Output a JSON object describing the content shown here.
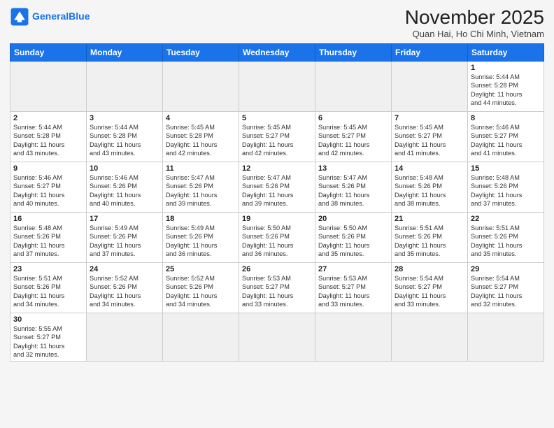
{
  "header": {
    "logo_general": "General",
    "logo_blue": "Blue",
    "month_title": "November 2025",
    "location": "Quan Hai, Ho Chi Minh, Vietnam"
  },
  "weekdays": [
    "Sunday",
    "Monday",
    "Tuesday",
    "Wednesday",
    "Thursday",
    "Friday",
    "Saturday"
  ],
  "weeks": [
    [
      {
        "day": "",
        "info": ""
      },
      {
        "day": "",
        "info": ""
      },
      {
        "day": "",
        "info": ""
      },
      {
        "day": "",
        "info": ""
      },
      {
        "day": "",
        "info": ""
      },
      {
        "day": "",
        "info": ""
      },
      {
        "day": "1",
        "info": "Sunrise: 5:44 AM\nSunset: 5:28 PM\nDaylight: 11 hours\nand 44 minutes."
      }
    ],
    [
      {
        "day": "2",
        "info": "Sunrise: 5:44 AM\nSunset: 5:28 PM\nDaylight: 11 hours\nand 43 minutes."
      },
      {
        "day": "3",
        "info": "Sunrise: 5:44 AM\nSunset: 5:28 PM\nDaylight: 11 hours\nand 43 minutes."
      },
      {
        "day": "4",
        "info": "Sunrise: 5:45 AM\nSunset: 5:28 PM\nDaylight: 11 hours\nand 42 minutes."
      },
      {
        "day": "5",
        "info": "Sunrise: 5:45 AM\nSunset: 5:27 PM\nDaylight: 11 hours\nand 42 minutes."
      },
      {
        "day": "6",
        "info": "Sunrise: 5:45 AM\nSunset: 5:27 PM\nDaylight: 11 hours\nand 42 minutes."
      },
      {
        "day": "7",
        "info": "Sunrise: 5:45 AM\nSunset: 5:27 PM\nDaylight: 11 hours\nand 41 minutes."
      },
      {
        "day": "8",
        "info": "Sunrise: 5:46 AM\nSunset: 5:27 PM\nDaylight: 11 hours\nand 41 minutes."
      }
    ],
    [
      {
        "day": "9",
        "info": "Sunrise: 5:46 AM\nSunset: 5:27 PM\nDaylight: 11 hours\nand 40 minutes."
      },
      {
        "day": "10",
        "info": "Sunrise: 5:46 AM\nSunset: 5:26 PM\nDaylight: 11 hours\nand 40 minutes."
      },
      {
        "day": "11",
        "info": "Sunrise: 5:47 AM\nSunset: 5:26 PM\nDaylight: 11 hours\nand 39 minutes."
      },
      {
        "day": "12",
        "info": "Sunrise: 5:47 AM\nSunset: 5:26 PM\nDaylight: 11 hours\nand 39 minutes."
      },
      {
        "day": "13",
        "info": "Sunrise: 5:47 AM\nSunset: 5:26 PM\nDaylight: 11 hours\nand 38 minutes."
      },
      {
        "day": "14",
        "info": "Sunrise: 5:48 AM\nSunset: 5:26 PM\nDaylight: 11 hours\nand 38 minutes."
      },
      {
        "day": "15",
        "info": "Sunrise: 5:48 AM\nSunset: 5:26 PM\nDaylight: 11 hours\nand 37 minutes."
      }
    ],
    [
      {
        "day": "16",
        "info": "Sunrise: 5:48 AM\nSunset: 5:26 PM\nDaylight: 11 hours\nand 37 minutes."
      },
      {
        "day": "17",
        "info": "Sunrise: 5:49 AM\nSunset: 5:26 PM\nDaylight: 11 hours\nand 37 minutes."
      },
      {
        "day": "18",
        "info": "Sunrise: 5:49 AM\nSunset: 5:26 PM\nDaylight: 11 hours\nand 36 minutes."
      },
      {
        "day": "19",
        "info": "Sunrise: 5:50 AM\nSunset: 5:26 PM\nDaylight: 11 hours\nand 36 minutes."
      },
      {
        "day": "20",
        "info": "Sunrise: 5:50 AM\nSunset: 5:26 PM\nDaylight: 11 hours\nand 35 minutes."
      },
      {
        "day": "21",
        "info": "Sunrise: 5:51 AM\nSunset: 5:26 PM\nDaylight: 11 hours\nand 35 minutes."
      },
      {
        "day": "22",
        "info": "Sunrise: 5:51 AM\nSunset: 5:26 PM\nDaylight: 11 hours\nand 35 minutes."
      }
    ],
    [
      {
        "day": "23",
        "info": "Sunrise: 5:51 AM\nSunset: 5:26 PM\nDaylight: 11 hours\nand 34 minutes."
      },
      {
        "day": "24",
        "info": "Sunrise: 5:52 AM\nSunset: 5:26 PM\nDaylight: 11 hours\nand 34 minutes."
      },
      {
        "day": "25",
        "info": "Sunrise: 5:52 AM\nSunset: 5:26 PM\nDaylight: 11 hours\nand 34 minutes."
      },
      {
        "day": "26",
        "info": "Sunrise: 5:53 AM\nSunset: 5:27 PM\nDaylight: 11 hours\nand 33 minutes."
      },
      {
        "day": "27",
        "info": "Sunrise: 5:53 AM\nSunset: 5:27 PM\nDaylight: 11 hours\nand 33 minutes."
      },
      {
        "day": "28",
        "info": "Sunrise: 5:54 AM\nSunset: 5:27 PM\nDaylight: 11 hours\nand 33 minutes."
      },
      {
        "day": "29",
        "info": "Sunrise: 5:54 AM\nSunset: 5:27 PM\nDaylight: 11 hours\nand 32 minutes."
      }
    ],
    [
      {
        "day": "30",
        "info": "Sunrise: 5:55 AM\nSunset: 5:27 PM\nDaylight: 11 hours\nand 32 minutes."
      },
      {
        "day": "",
        "info": ""
      },
      {
        "day": "",
        "info": ""
      },
      {
        "day": "",
        "info": ""
      },
      {
        "day": "",
        "info": ""
      },
      {
        "day": "",
        "info": ""
      },
      {
        "day": "",
        "info": ""
      }
    ]
  ]
}
